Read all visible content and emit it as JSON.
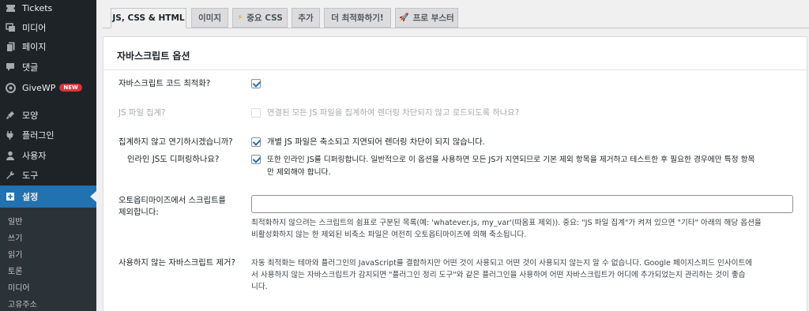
{
  "sidebar": {
    "items": [
      {
        "label": "Tickets",
        "icon": "tickets-icon"
      },
      {
        "label": "미디어",
        "icon": "media-icon"
      },
      {
        "label": "페이지",
        "icon": "page-icon"
      },
      {
        "label": "댓글",
        "icon": "comments-icon"
      },
      {
        "label": "GiveWP",
        "icon": "givewp-icon",
        "badge": "NEW"
      },
      {
        "label": "모양",
        "icon": "appearance-icon"
      },
      {
        "label": "플러그인",
        "icon": "plugins-icon"
      },
      {
        "label": "사용자",
        "icon": "users-icon"
      },
      {
        "label": "도구",
        "icon": "tools-icon"
      },
      {
        "label": "설정",
        "icon": "settings-icon",
        "active": true
      }
    ],
    "submenu": [
      "일반",
      "쓰기",
      "읽기",
      "토론",
      "미디어",
      "고유주소"
    ]
  },
  "tabs": [
    {
      "label": "JS, CSS & HTML",
      "active": true
    },
    {
      "label": "이미지"
    },
    {
      "label": "중요 CSS",
      "icon": "⚡"
    },
    {
      "label": "추가"
    },
    {
      "label": "더 최적화하기!"
    },
    {
      "label": "프로 부스터",
      "icon": "🚀"
    }
  ],
  "panel": {
    "title": "자바스크립트 옵션",
    "js_optimize": {
      "label": "자바스크립트 코드 최적화?",
      "checked": true
    },
    "js_aggregate": {
      "label": "JS 파일 집계?",
      "checkbox_text": "연결된 모든 JS 파일을 집계하여 렌더링 차단되지 않고 로드되도록 하나요?",
      "checked": false,
      "disabled": true
    },
    "js_defer": {
      "label": "집계하지 않고 연기하시겠습니까?",
      "checkbox_text": "개별 JS 파일은 축소되고 지연되어 렌더링 차단이 되지 않습니다.",
      "checked": true
    },
    "js_defer_inline": {
      "label": "인라인 JS도 디퍼링하나요?",
      "checkbox_text_line1": "또한 인라인 JS를 디퍼링합니다. 일반적으로 이 옵션을 사용하면 모든 JS가 지연되므로 기본 제외 항목을 제거하고 테스트한 후 필요한 경우에만 특정 항목",
      "checkbox_text_line2": "만 제외해야 합니다.",
      "checked": true
    },
    "js_exclude": {
      "label_line1": "오토옵티마이즈에서 스크립트를",
      "label_line2": "제외합니다:",
      "value": "",
      "desc_line1": "최적화하지 않으려는 스크립트의 쉼표로 구분된 목록(예: 'whatever.js, my_var'(따옴표 제외)). 중요: \"JS 파일 집계\"가 켜져 있으면 \"기타\" 아래의 해당 옵션을",
      "desc_line2": "비활성화하지 않는 한 제외된 비축소 파일은 여전히 오토옵티마이즈에 의해 축소됩니다."
    },
    "js_unused": {
      "label": "사용하지 않는 자바스크립트 제거?",
      "desc_line1": "자동 최적화는 테마와 플러그인의 JavaScript를 결합하지만 어떤 것이 사용되고 어떤 것이 사용되지 않는지 알 수 없습니다. Google 페이지스피드 인사이트에",
      "desc_line2": "서 사용하지 않는 자바스크립트가 감지되면 \"플러그인 정리 도구\"와 같은 플러그인을 사용하여 어떤 자바스크립트가 어디에 추가되었는지 관리하는 것이 좋습",
      "desc_line3": "니다."
    }
  },
  "colors": {
    "sidebar_bg": "#1d2327",
    "active_menu": "#2271b1",
    "badge": "#d63638",
    "checkbox_check": "#2271b1"
  }
}
